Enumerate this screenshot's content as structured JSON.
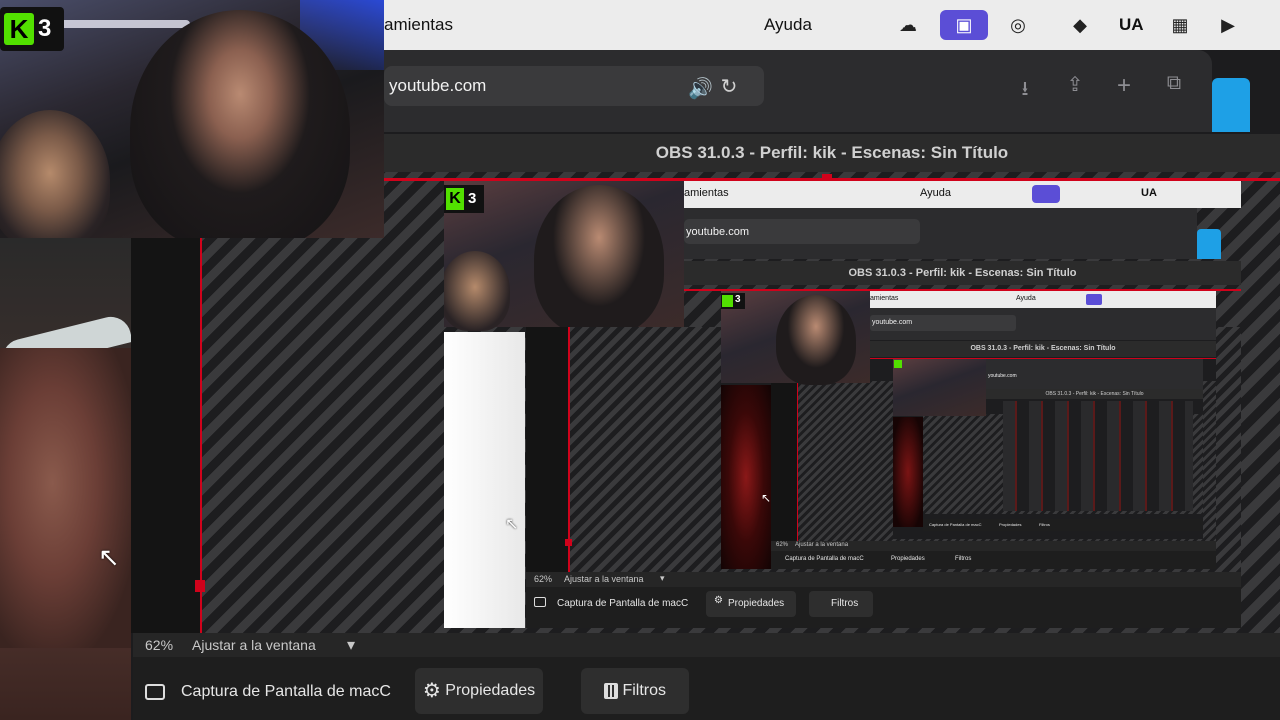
{
  "menubar": {
    "menu_partial": "amientas",
    "help": "Ayuda",
    "ua": "UA",
    "icons": [
      "creative-cloud-icon",
      "screen-mirror-icon",
      "airplay-icon",
      "ua-logo-icon",
      "ua-text",
      "wifi-grid-icon",
      "play-icon"
    ]
  },
  "browser": {
    "url": "youtube.com"
  },
  "obs": {
    "title": "OBS 31.0.3 - Perfil: kik - Escenas: Sin Título",
    "zoom": "62%",
    "fit_label": "Ajustar a la ventana",
    "source_name": "Captura de Pantalla de macC",
    "properties_label": "Propiedades",
    "filters_label": "Filtros"
  },
  "webcam": {
    "badge_number": "3"
  },
  "nested1": {
    "menu_partial": "amientas",
    "help": "Ayuda",
    "ua": "UA",
    "url": "youtube.com",
    "title": "OBS 31.0.3 - Perfil: kik - Escenas: Sin Título",
    "zoom": "62%",
    "fit_label": "Ajustar a la ventana",
    "source_name": "Captura de Pantalla de macC",
    "properties_label": "Propiedades",
    "filters_label": "Filtros",
    "badge_number": "3"
  },
  "nested2": {
    "menu_partial": "amientas",
    "help": "Ayuda",
    "url": "youtube.com",
    "title": "OBS 31.0.3 - Perfil: kik - Escenas: Sin Título",
    "zoom": "62%",
    "fit_label": "Ajustar a la ventana",
    "source_name": "Captura de Pantalla de macC",
    "properties_label": "Propiedades",
    "filters_label": "Filtros",
    "badge_number": "3"
  },
  "nested3": {
    "url": "youtube.com",
    "title": "OBS 31.0.3 - Perfil: kik - Escenas: Sin Título",
    "source_name": "Captura de Pantalla de macC",
    "properties_label": "Propiedades",
    "filters_label": "Filtros"
  },
  "colors": {
    "accent": "#5b4ed6",
    "red": "#d0021b",
    "k3_green": "#52e000"
  }
}
